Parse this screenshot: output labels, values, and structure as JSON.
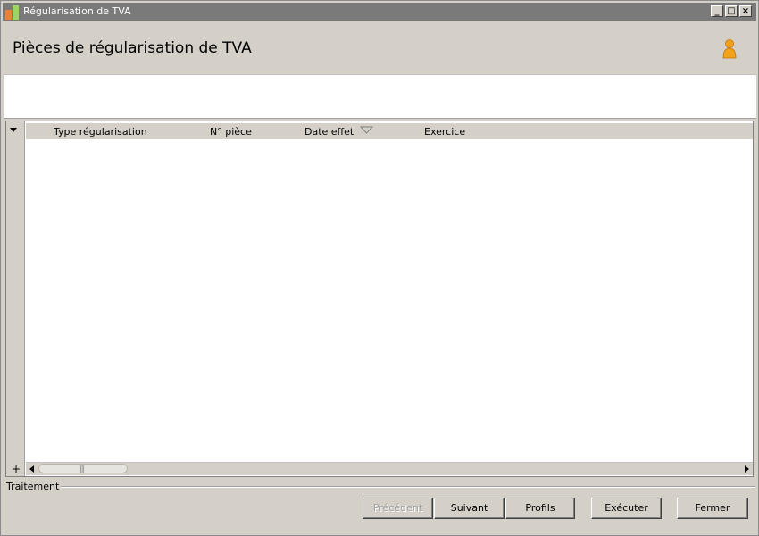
{
  "window": {
    "title": "Régularisation de TVA"
  },
  "header": {
    "title": "Pièces de régularisation de TVA"
  },
  "grid": {
    "columns": [
      "Type régularisation",
      "N° pièce",
      "Date effet",
      "Exercice"
    ],
    "rows": []
  },
  "section": {
    "label": "Traitement"
  },
  "buttons": {
    "previous": "Précédent",
    "next": "Suivant",
    "profiles": "Profils",
    "execute": "Exécuter",
    "close": "Fermer"
  },
  "scroll": {
    "plus": "+"
  }
}
